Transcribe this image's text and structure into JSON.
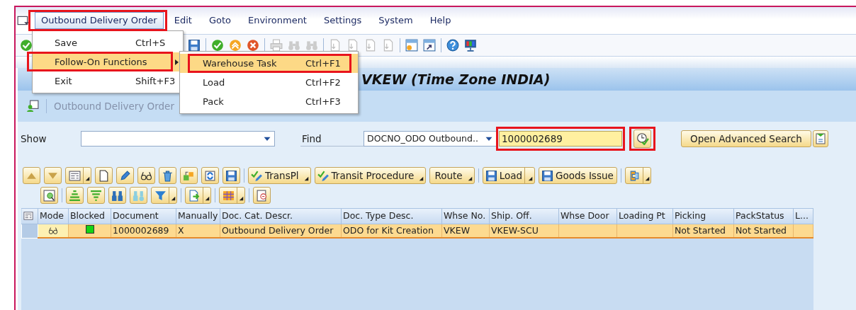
{
  "menu_bar": [
    {
      "label": "Outbound Delivery Order",
      "selected": true,
      "highlighted": true
    },
    {
      "label": "Edit",
      "selected": false
    },
    {
      "label": "Goto",
      "selected": false
    },
    {
      "label": "Environment",
      "selected": false
    },
    {
      "label": "Settings",
      "selected": false
    },
    {
      "label": "System",
      "selected": false
    },
    {
      "label": "Help",
      "selected": false
    }
  ],
  "menu": {
    "items": [
      {
        "label": "Save",
        "shortcut": "Ctrl+S",
        "selected": false,
        "submenu": false
      },
      {
        "label": "Follow-On Functions",
        "selected": true,
        "submenu": true,
        "highlighted": true
      },
      {
        "label": "Exit",
        "shortcut": "Shift+F3",
        "selected": false,
        "submenu": false
      }
    ]
  },
  "submenu": {
    "items": [
      {
        "label": "Warehouse Task",
        "shortcut": "Ctrl+F1",
        "selected": true,
        "highlighted": true
      },
      {
        "label": "Load",
        "shortcut": "Ctrl+F2",
        "selected": false
      },
      {
        "label": "Pack",
        "shortcut": "Ctrl+F3",
        "selected": false
      }
    ]
  },
  "title": "VKEW (Time Zone INDIA)",
  "app_toolbar": {
    "label": "Outbound Delivery Order",
    "disabled": true
  },
  "search": {
    "show_label": "Show",
    "find_label": "Find",
    "find_by": "DOCNO_ODO Outbound..",
    "value": "1000002689",
    "value_highlighted": true,
    "search_button_highlighted": true,
    "advanced_button": "Open Advanced Search"
  },
  "toolbar_buttons": [
    {
      "label": "TransPl",
      "kind": "confirm",
      "dropdown": true
    },
    {
      "label": "Transit Procedure",
      "kind": "confirm",
      "dropdown": true
    },
    {
      "label": "Route",
      "kind": "text",
      "dropdown": true
    },
    {
      "label": "Load",
      "kind": "save",
      "dropdown": true
    },
    {
      "label": "Goods Issue",
      "kind": "save",
      "dropdown": false
    }
  ],
  "table": {
    "columns": [
      "Mode",
      "Blocked",
      "Document",
      "Manually",
      "Doc. Cat. Descr.",
      "Doc. Type Desc.",
      "Whse No.",
      "Ship. Off.",
      "Whse Door",
      "Loading Pt",
      "Picking",
      "PackStatus",
      "L..."
    ],
    "rows": [
      {
        "selected": true,
        "blocked": false,
        "document": "1000002689",
        "manually": "X",
        "doc_cat_descr": "Outbound Delivery Order",
        "doc_type_desc": "ODO for Kit Creation",
        "whse_no": "VKEW",
        "ship_off": "VKEW-SCU",
        "picking": "Not Started",
        "pack_status": "Not Started"
      }
    ]
  }
}
